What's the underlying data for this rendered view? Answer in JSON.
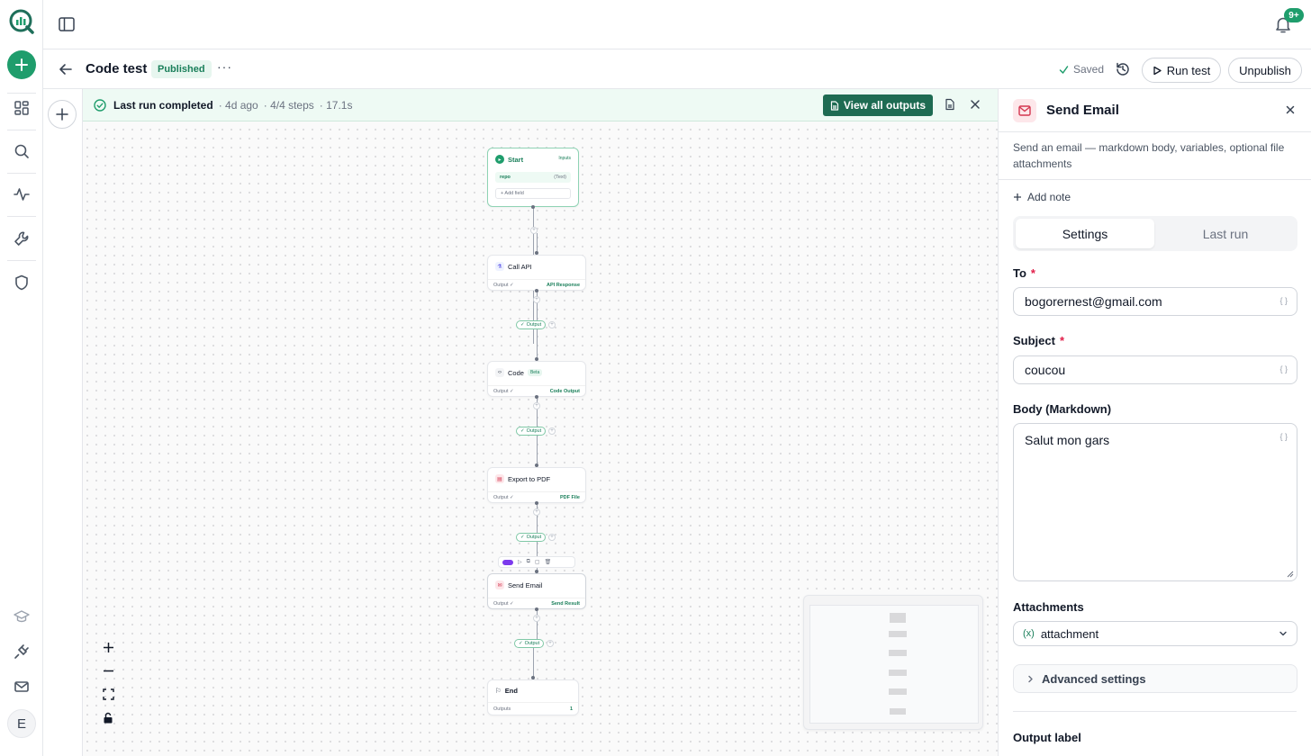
{
  "rail": {
    "user_initial": "E"
  },
  "topbar": {
    "notifications_badge": "9+"
  },
  "workflow": {
    "title": "Code test",
    "status": "Published",
    "saved_label": "Saved",
    "run_test_label": "Run test",
    "unpublish_label": "Unpublish"
  },
  "run": {
    "status": "Last run completed",
    "ago": "· 4d ago",
    "steps": "· 4/4 steps",
    "duration": "· 17.1s",
    "view_all_label": "View all outputs"
  },
  "nodes": {
    "start": {
      "title": "Start",
      "tag": "Inputs",
      "field_name": "repo",
      "field_type": "(Text)",
      "add_field": "+ Add field"
    },
    "call_api": {
      "title": "Call API",
      "output": "Output ✓",
      "result": "API Response"
    },
    "code": {
      "title": "Code",
      "badge": "Beta",
      "output": "Output ✓",
      "result": "Code Output"
    },
    "export": {
      "title": "Export to PDF",
      "output": "Output ✓",
      "result": "PDF File"
    },
    "send_email": {
      "title": "Send Email",
      "output": "Output ✓",
      "result": "Send Result"
    },
    "end": {
      "title": "End",
      "outputs_label": "Outputs",
      "outputs_count": "1"
    },
    "output_pill": "Output"
  },
  "panel": {
    "title": "Send Email",
    "description": "Send an email — markdown body, variables, optional file attachments",
    "add_note": "Add note",
    "tabs": {
      "settings": "Settings",
      "last_run": "Last run"
    },
    "to_label": "To",
    "to_value": "bogorernest@gmail.com",
    "subject_label": "Subject",
    "subject_value": "coucou",
    "body_label": "Body (Markdown)",
    "body_value": "Salut mon gars",
    "attachments_label": "Attachments",
    "attachments_value": "attachment",
    "advanced_label": "Advanced settings",
    "output_label": "Output label",
    "required_mark": "*",
    "var_hint": "{ }"
  },
  "colors": {
    "brand": "#1f9d6c",
    "dark_brand": "#1e6b52",
    "email_accent": "#d4364f"
  },
  "icons": [
    "logo-icon",
    "plus-icon",
    "dashboard-icon",
    "search-icon",
    "activity-icon",
    "wrench-icon",
    "shield-icon",
    "graduation-cap-icon",
    "plug-icon",
    "mail-icon",
    "sidebar-toggle-icon",
    "bell-icon",
    "back-arrow-icon",
    "history-icon",
    "play-icon",
    "check-circle-icon",
    "file-icon",
    "close-icon",
    "chevron-down-icon",
    "chevron-right-icon",
    "variable-icon"
  ]
}
